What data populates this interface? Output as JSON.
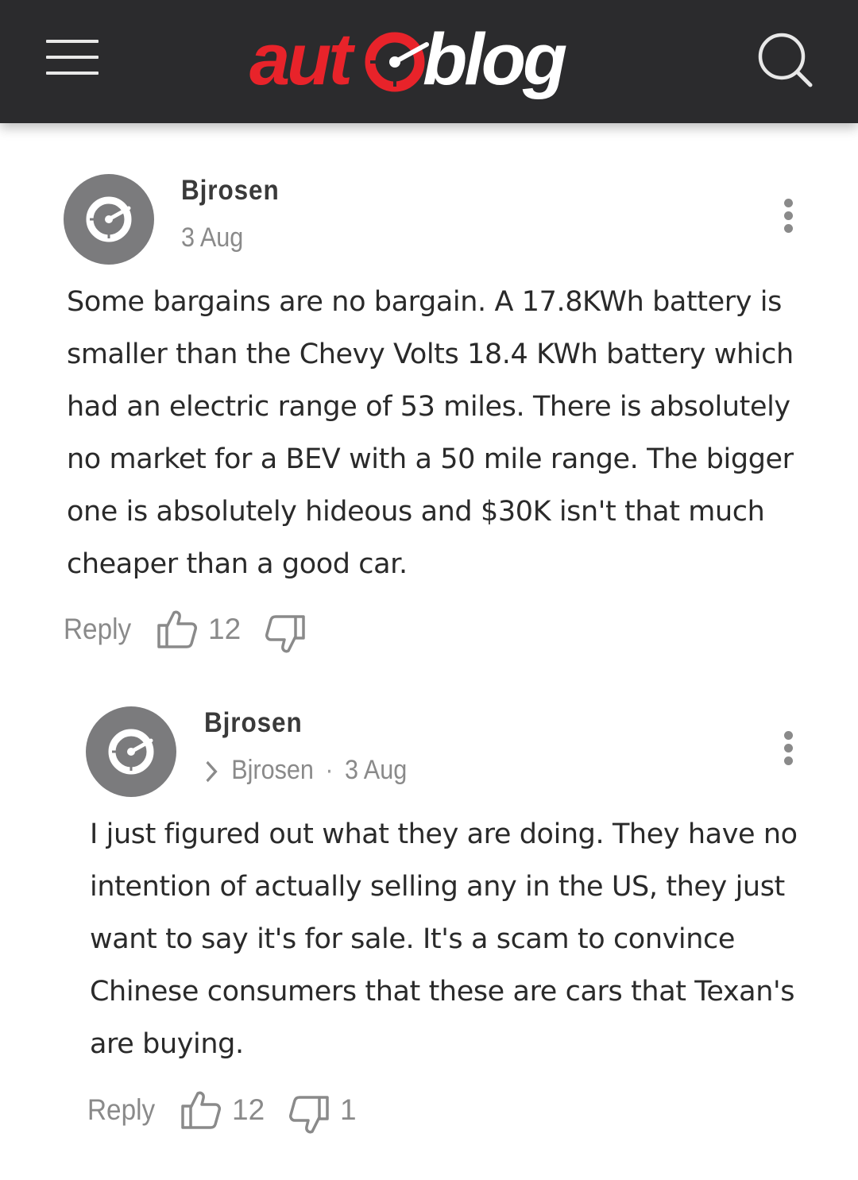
{
  "header": {
    "logo_text_left": "aut",
    "logo_text_right": "blog",
    "menu_icon": "hamburger-menu-icon",
    "search_icon": "search-icon"
  },
  "colors": {
    "header_bg": "#2b2b2d",
    "logo_red": "#e8232a",
    "avatar_gray": "#7b7b7d"
  },
  "comments": [
    {
      "username": "Bjrosen",
      "date": "3 Aug",
      "text": "Some bargains are no bargain. A 17.8KWh battery is smaller than the Chevy Volts 18.4 KWh battery which had an electric range of 53 miles. There is absolutely no market for a BEV with a 50 mile range. The bigger one is absolutely hideous and $30K isn't that much cheaper than a good car.",
      "reply_label": "Reply",
      "upvotes": "12",
      "downvotes": ""
    },
    {
      "username": "Bjrosen",
      "reply_to": "Bjrosen",
      "separator": "·",
      "date": "3 Aug",
      "text": "I just figured out what they are doing. They have no intention of actually selling any in the US, they just want to say it's for sale. It's a scam to convince Chinese consumers that these are cars that Texan's are buying.",
      "reply_label": "Reply",
      "upvotes": "12",
      "downvotes": "1"
    }
  ]
}
